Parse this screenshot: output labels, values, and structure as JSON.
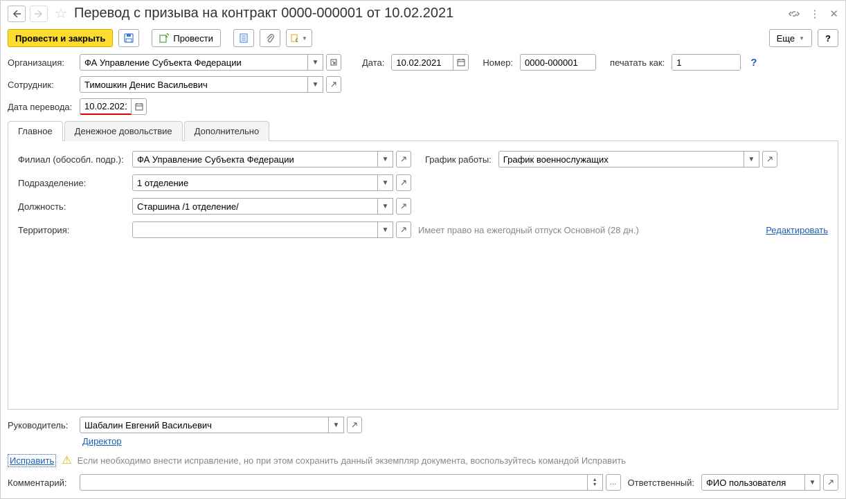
{
  "title": "Перевод с призыва на контракт 0000-000001 от 10.02.2021",
  "toolbar": {
    "post_close": "Провести и закрыть",
    "post": "Провести",
    "more": "Еще"
  },
  "header": {
    "org_label": "Организация:",
    "org_value": "ФА Управление Субъекта Федерации",
    "date_label": "Дата:",
    "date_value": "10.02.2021",
    "number_label": "Номер:",
    "number_value": "0000-000001",
    "print_as_label": "печатать как:",
    "print_as_value": "1",
    "employee_label": "Сотрудник:",
    "employee_value": "Тимошкин Денис Васильевич",
    "transfer_date_label": "Дата перевода:",
    "transfer_date_value": "10.02.2021"
  },
  "tabs": {
    "main": "Главное",
    "allowance": "Денежное довольствие",
    "additional": "Дополнительно"
  },
  "main_tab": {
    "branch_label": "Филиал (обособл. подр.):",
    "branch_value": "ФА Управление Субъекта Федерации",
    "schedule_label": "График работы:",
    "schedule_value": "График военнослужащих",
    "division_label": "Подразделение:",
    "division_value": "1 отделение",
    "position_label": "Должность:",
    "position_value": "Старшина /1 отделение/",
    "territory_label": "Территория:",
    "territory_value": "",
    "vacation_text": "Имеет право на ежегодный отпуск Основной (28 дн.)",
    "edit_link": "Редактировать"
  },
  "footer": {
    "manager_label": "Руководитель:",
    "manager_value": "Шабалин Евгений Васильевич",
    "manager_role": "Директор",
    "correct_link": "Исправить",
    "warning_text": "Если необходимо внести исправление, но при этом сохранить данный экземпляр документа, воспользуйтесь командой Исправить",
    "comment_label": "Комментарий:",
    "responsible_label": "Ответственный:",
    "responsible_value": "ФИО пользователя"
  }
}
